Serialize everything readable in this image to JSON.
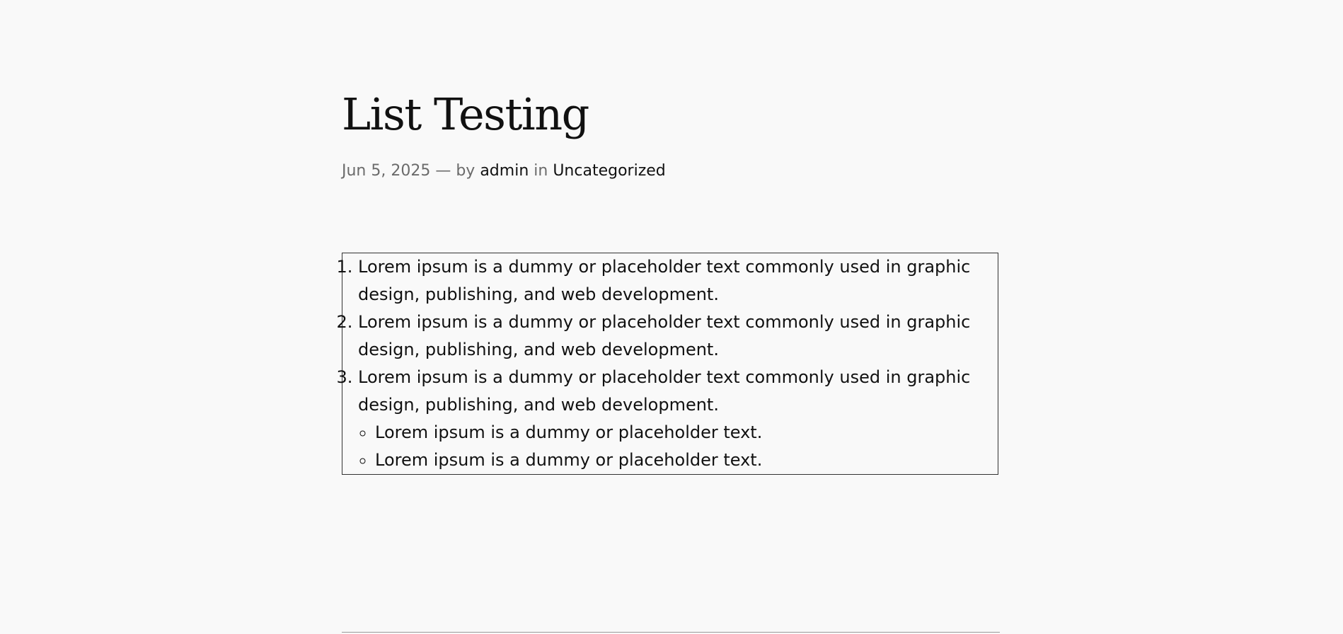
{
  "post": {
    "title": "List Testing",
    "meta": {
      "date": "Jun 5, 2025",
      "separator": "—",
      "by_label": "by",
      "author": "admin",
      "in_label": "in",
      "category": "Uncategorized"
    }
  },
  "list": {
    "ordered_items": [
      "Lorem ipsum is a dummy or placeholder text commonly used in graphic design, publishing, and web development.",
      "Lorem ipsum is a dummy or placeholder text commonly used in graphic design, publishing, and web development.",
      "Lorem ipsum is a dummy or placeholder text commonly used in graphic design, publishing, and web development."
    ],
    "nested_bullets": [
      "Lorem ipsum is a dummy or placeholder text.",
      "Lorem ipsum is a dummy or placeholder text."
    ]
  }
}
